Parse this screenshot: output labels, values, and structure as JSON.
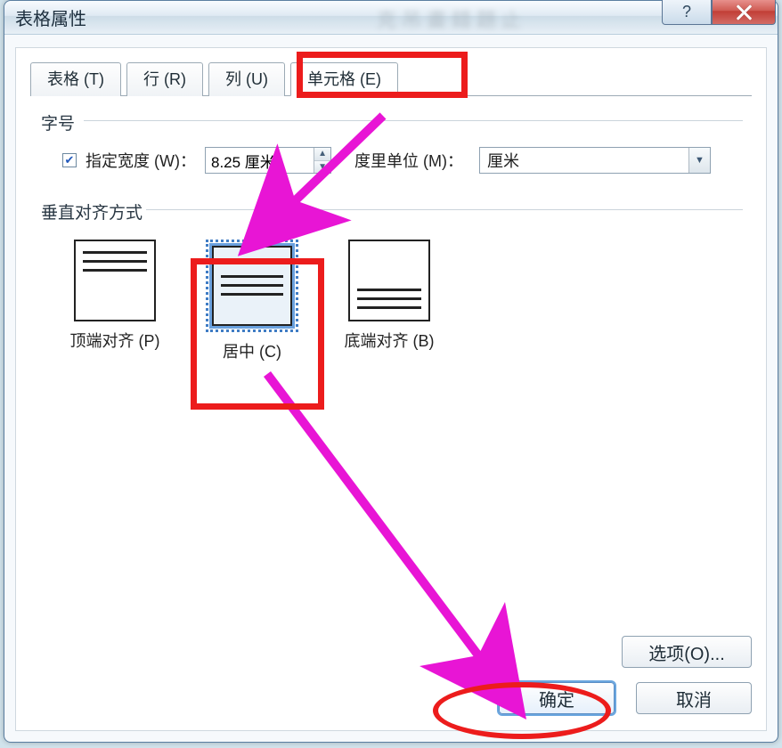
{
  "window": {
    "title": "表格属性"
  },
  "tabs": {
    "table": "表格 (T)",
    "row": "行 (R)",
    "column": "列 (U)",
    "cell": "单元格 (E)"
  },
  "size_section": {
    "legend": "字号",
    "checkbox_label": "指定宽度 (W)：",
    "checked": true,
    "width_value": "8.25 厘米",
    "unit_label": "度里单位 (M)：",
    "unit_value": "厘米"
  },
  "valign_section": {
    "legend": "垂直对齐方式",
    "options": {
      "top": "顶端对齐 (P)",
      "center": "居中 (C)",
      "bottom": "底端对齐 (B)"
    },
    "selected": "center"
  },
  "buttons": {
    "options": "选项(O)...",
    "ok": "确定",
    "cancel": "取消"
  },
  "sysbuttons": {
    "help": "?",
    "close": "×"
  }
}
